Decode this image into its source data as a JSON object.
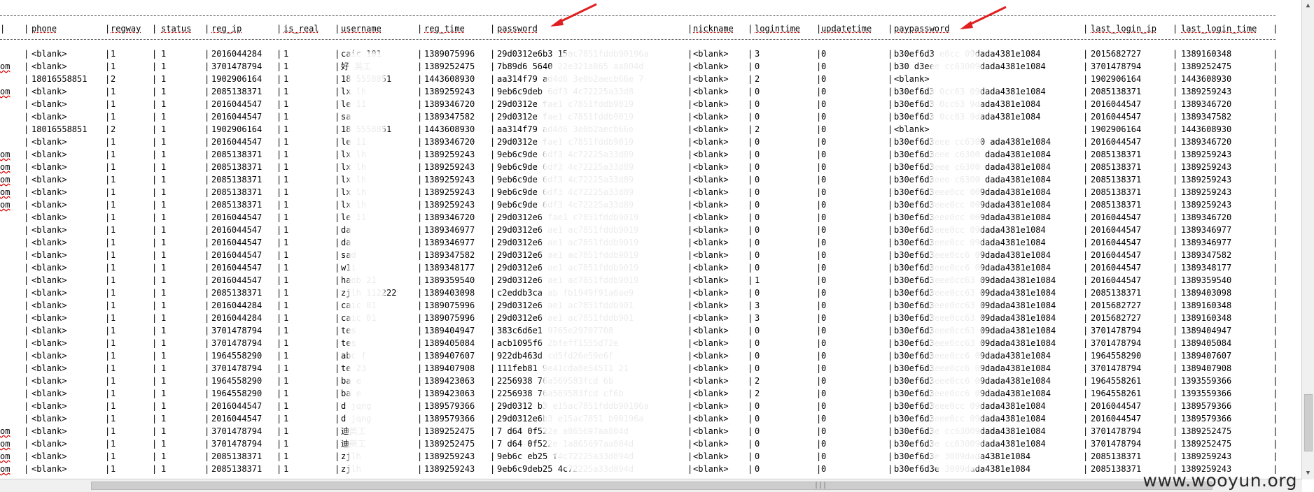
{
  "watermark": "www.wooyun.org",
  "columns": [
    "phone",
    "regway",
    "status",
    "reg_ip",
    "is_real",
    "username",
    "reg_time",
    "password",
    "nickname",
    "logintime",
    "updatetime",
    "paypassword",
    "last_login_ip",
    "last_login_time"
  ],
  "rows": [
    {
      "lead": "",
      "phone": "<blank>",
      "regway": "1",
      "status": "1",
      "reg_ip": "2016044284",
      "is_real": "1",
      "username": "caic  101",
      "reg_time": "1389075996",
      "password": "29d0312e6b3  15ac7851fddb90196a",
      "nickname": "<blank>",
      "logintime": "3",
      "updatetime": "0",
      "paypassword": "b30ef6d3  e0cc  09dada4381e1084",
      "last_login_ip": "2015682727",
      "last_login_time": "1389160348"
    },
    {
      "lead": "om",
      "phone": "<blank>",
      "regway": "1",
      "status": "1",
      "reg_ip": "3701478794",
      "is_real": "1",
      "username": "好  美工",
      "reg_time": "1389252475",
      "password": "7b89d6  5640  22e321a865  aa804d",
      "nickname": "<blank>",
      "logintime": "0",
      "updatetime": "0",
      "paypassword": "b30  d3eee  cc63009dada4381e1084",
      "last_login_ip": "3701478794",
      "last_login_time": "1389252475"
    },
    {
      "lead": "",
      "phone": "18016558851",
      "regway": "2",
      "status": "1",
      "reg_ip": "1902906164",
      "is_real": "1",
      "username": "18  5558851",
      "reg_time": "1443608930",
      "password": "aa314f79  ad4d6  3e0b2aecb66e  7",
      "nickname": "<blank>",
      "logintime": "2",
      "updatetime": "0",
      "paypassword": "<blank>",
      "last_login_ip": "1902906164",
      "last_login_time": "1443608930"
    },
    {
      "lead": "om",
      "phone": "<blank>",
      "regway": "1",
      "status": "1",
      "reg_ip": "2085138371",
      "is_real": "1",
      "username": "lx  lh",
      "reg_time": "1389259243",
      "password": "9eb6c9deb  6df3  4c72225a33d8",
      "nickname": "<blank>",
      "logintime": "0",
      "updatetime": "0",
      "paypassword": "b30ef6d3  0cc63  09dada4381e1084",
      "last_login_ip": "2085138371",
      "last_login_time": "1389259243"
    },
    {
      "lead": "",
      "phone": "<blank>",
      "regway": "1",
      "status": "1",
      "reg_ip": "2016044547",
      "is_real": "1",
      "username": "le  11",
      "reg_time": "1389346720",
      "password": "29d0312e  fae1  c7851fddb9019",
      "nickname": "<blank>",
      "logintime": "0",
      "updatetime": "0",
      "paypassword": "b30ef6d3  0cc63  9dada4381e1084",
      "last_login_ip": "2016044547",
      "last_login_time": "1389346720"
    },
    {
      "lead": "",
      "phone": "<blank>",
      "regway": "1",
      "status": "1",
      "reg_ip": "2016044547",
      "is_real": "1",
      "username": "sa",
      "reg_time": "1389347582",
      "password": "29d0312e  fae1  c7851fddb9019",
      "nickname": "<blank>",
      "logintime": "0",
      "updatetime": "0",
      "paypassword": "b30ef6d3  0cc63  9dada4381e1084",
      "last_login_ip": "2016044547",
      "last_login_time": "1389347582"
    },
    {
      "lead": "",
      "phone": "18016558851",
      "regway": "2",
      "status": "1",
      "reg_ip": "1902906164",
      "is_real": "1",
      "username": "18  5558851",
      "reg_time": "1443608930",
      "password": "aa314f79  ad4d6  3e0b2aecb66e",
      "nickname": "<blank>",
      "logintime": "2",
      "updatetime": "0",
      "paypassword": "<blank>",
      "last_login_ip": "1902906164",
      "last_login_time": "1443608930"
    },
    {
      "lead": "",
      "phone": "<blank>",
      "regway": "1",
      "status": "1",
      "reg_ip": "2016044547",
      "is_real": "1",
      "username": "le  11",
      "reg_time": "1389346720",
      "password": "29d0312e  fae1  c7851fddb9019",
      "nickname": "<blank>",
      "logintime": "0",
      "updatetime": "0",
      "paypassword": "b30ef6d3eee  cc6300  ada4381e1084",
      "last_login_ip": "2016044547",
      "last_login_time": "1389346720"
    },
    {
      "lead": "om",
      "phone": "<blank>",
      "regway": "1",
      "status": "1",
      "reg_ip": "2085138371",
      "is_real": "1",
      "username": "lx  lh",
      "reg_time": "1389259243",
      "password": "9eb6c9de  6df3  4c72225a33d89",
      "nickname": "<blank>",
      "logintime": "0",
      "updatetime": "0",
      "paypassword": "b30ef6d3eee  c6300  dada4381e1084",
      "last_login_ip": "2085138371",
      "last_login_time": "1389259243"
    },
    {
      "lead": "om",
      "phone": "<blank>",
      "regway": "1",
      "status": "1",
      "reg_ip": "2085138371",
      "is_real": "1",
      "username": "lx  lh",
      "reg_time": "1389259243",
      "password": "9eb6c9de  6df3  4c72225a33d89",
      "nickname": "<blank>",
      "logintime": "0",
      "updatetime": "0",
      "paypassword": "b30ef6d3eee  c6300  dada4381e1084",
      "last_login_ip": "2085138371",
      "last_login_time": "1389259243"
    },
    {
      "lead": "om",
      "phone": "<blank>",
      "regway": "1",
      "status": "1",
      "reg_ip": "2085138371",
      "is_real": "1",
      "username": "lx  lh",
      "reg_time": "1389259243",
      "password": "9eb6c9de  6df3  4c72225a33d89",
      "nickname": "<blank>",
      "logintime": "0",
      "updatetime": "0",
      "paypassword": "b30ef6d3eee  c6300  dada4381e1084",
      "last_login_ip": "2085138371",
      "last_login_time": "1389259243"
    },
    {
      "lead": "om",
      "phone": "<blank>",
      "regway": "1",
      "status": "1",
      "reg_ip": "2085138371",
      "is_real": "1",
      "username": "lx  lh",
      "reg_time": "1389259243",
      "password": "9eb6c9de  6df3  4c72225a33d89",
      "nickname": "<blank>",
      "logintime": "0",
      "updatetime": "0",
      "paypassword": "b30ef6d3eee0cc  009dada4381e1084",
      "last_login_ip": "2085138371",
      "last_login_time": "1389259243"
    },
    {
      "lead": "om",
      "phone": "<blank>",
      "regway": "1",
      "status": "1",
      "reg_ip": "2085138371",
      "is_real": "1",
      "username": "lx  lh",
      "reg_time": "1389259243",
      "password": "9eb6c9de  6df3  4c72225a33d89",
      "nickname": "<blank>",
      "logintime": "0",
      "updatetime": "0",
      "paypassword": "b30ef6d3eee0cc  009dada4381e1084",
      "last_login_ip": "2085138371",
      "last_login_time": "1389259243"
    },
    {
      "lead": "",
      "phone": "<blank>",
      "regway": "1",
      "status": "1",
      "reg_ip": "2016044547",
      "is_real": "1",
      "username": "le  11",
      "reg_time": "1389346720",
      "password": "29d0312e6  fae1  c7851fddb9019",
      "nickname": "<blank>",
      "logintime": "0",
      "updatetime": "0",
      "paypassword": "b30ef6d3eee0cc  009dada4381e1084",
      "last_login_ip": "2016044547",
      "last_login_time": "1389346720"
    },
    {
      "lead": "",
      "phone": "<blank>",
      "regway": "1",
      "status": "1",
      "reg_ip": "2016044547",
      "is_real": "1",
      "username": "da",
      "reg_time": "1389346977",
      "password": "29d0312e6  ae1  ac7851fddb9019",
      "nickname": "<blank>",
      "logintime": "0",
      "updatetime": "0",
      "paypassword": "b30ef6d3eee0cc  09dada4381e1084",
      "last_login_ip": "2016044547",
      "last_login_time": "1389346977"
    },
    {
      "lead": "",
      "phone": "<blank>",
      "regway": "1",
      "status": "1",
      "reg_ip": "2016044547",
      "is_real": "1",
      "username": "da",
      "reg_time": "1389346977",
      "password": "29d0312e6  ae1  ac7851fddb9019",
      "nickname": "<blank>",
      "logintime": "0",
      "updatetime": "0",
      "paypassword": "b30ef6d3eee0cc  09dada4381e1084",
      "last_login_ip": "2016044547",
      "last_login_time": "1389346977"
    },
    {
      "lead": "",
      "phone": "<blank>",
      "regway": "1",
      "status": "1",
      "reg_ip": "2016044547",
      "is_real": "1",
      "username": "sad",
      "reg_time": "1389347582",
      "password": "29d0312e6  ae1  ac7851fddb9019",
      "nickname": "<blank>",
      "logintime": "0",
      "updatetime": "0",
      "paypassword": "b30ef6d3eee0cc6  09dada4381e1084",
      "last_login_ip": "2016044547",
      "last_login_time": "1389347582"
    },
    {
      "lead": "",
      "phone": "<blank>",
      "regway": "1",
      "status": "1",
      "reg_ip": "2016044547",
      "is_real": "1",
      "username": "w1i",
      "reg_time": "1389348177",
      "password": "29d0312e6  ae1  ac7851fddb9019",
      "nickname": "<blank>",
      "logintime": "0",
      "updatetime": "0",
      "paypassword": "b30ef6d3eee0cc6  09dada4381e1084",
      "last_login_ip": "2016044547",
      "last_login_time": "1389348177"
    },
    {
      "lead": "",
      "phone": "<blank>",
      "regway": "1",
      "status": "1",
      "reg_ip": "2016044547",
      "is_real": "1",
      "username": "haob  21",
      "reg_time": "1389359540",
      "password": "29d0312e6  ae1  ac7851fddb9019",
      "nickname": "<blank>",
      "logintime": "1",
      "updatetime": "0",
      "paypassword": "b30ef6d3eee0cc63  09dada4381e1084",
      "last_login_ip": "2016044547",
      "last_login_time": "1389359540"
    },
    {
      "lead": "",
      "phone": "<blank>",
      "regway": "1",
      "status": "1",
      "reg_ip": "2085138371",
      "is_real": "1",
      "username": "zjlh  112222",
      "reg_time": "1389403098",
      "password": "c2eddb3ca  ab  fb1949f91a6ae9",
      "nickname": "<blank>",
      "logintime": "0",
      "updatetime": "0",
      "paypassword": "b30ef6d3eee0cc63  09dada4381e1084",
      "last_login_ip": "2085138371",
      "last_login_time": "1389403098"
    },
    {
      "lead": "",
      "phone": "<blank>",
      "regway": "1",
      "status": "1",
      "reg_ip": "2016044284",
      "is_real": "1",
      "username": "caic  01",
      "reg_time": "1389075996",
      "password": "29d0312e6  ae1  ac7851fddb901",
      "nickname": "<blank>",
      "logintime": "3",
      "updatetime": "0",
      "paypassword": "b30ef6d3eee0cc63  09dada4381e1084",
      "last_login_ip": "2015682727",
      "last_login_time": "1389160348"
    },
    {
      "lead": "",
      "phone": "<blank>",
      "regway": "1",
      "status": "1",
      "reg_ip": "2016044284",
      "is_real": "1",
      "username": "caic  01",
      "reg_time": "1389075996",
      "password": "29d0312e6  ae1  ac7851fddb901",
      "nickname": "<blank>",
      "logintime": "3",
      "updatetime": "0",
      "paypassword": "b30ef6d3eee0cc63  09dada4381e1084",
      "last_login_ip": "2015682727",
      "last_login_time": "1389160348"
    },
    {
      "lead": "",
      "phone": "<blank>",
      "regway": "1",
      "status": "1",
      "reg_ip": "3701478794",
      "is_real": "1",
      "username": "tes",
      "reg_time": "1389404947",
      "password": "383c6d6e1  9765e29707708",
      "nickname": "<blank>",
      "logintime": "0",
      "updatetime": "0",
      "paypassword": "b30ef6d3eee0cc63  09dada4381e1084",
      "last_login_ip": "3701478794",
      "last_login_time": "1389404947"
    },
    {
      "lead": "",
      "phone": "<blank>",
      "regway": "1",
      "status": "1",
      "reg_ip": "3701478794",
      "is_real": "1",
      "username": "tes",
      "reg_time": "1389405084",
      "password": "acb1095f6  2bfeff1555d72e",
      "nickname": "<blank>",
      "logintime": "0",
      "updatetime": "0",
      "paypassword": "b30ef6d3eee0cc63  09dada4381e1084",
      "last_login_ip": "3701478794",
      "last_login_time": "1389405084"
    },
    {
      "lead": "",
      "phone": "<blank>",
      "regway": "1",
      "status": "1",
      "reg_ip": "1964558290",
      "is_real": "1",
      "username": "abc  f",
      "reg_time": "1389407607",
      "password": "922db463d  cd5fd26e59e6f",
      "nickname": "<blank>",
      "logintime": "0",
      "updatetime": "0",
      "paypassword": "b30ef6d3eee0cc6  09dada4381e1084",
      "last_login_ip": "1964558290",
      "last_login_time": "1389407607"
    },
    {
      "lead": "",
      "phone": "<blank>",
      "regway": "1",
      "status": "1",
      "reg_ip": "3701478794",
      "is_real": "1",
      "username": "te  23",
      "reg_time": "1389407908",
      "password": "111feb81  9e41cda8e54511  21",
      "nickname": "<blank>",
      "logintime": "0",
      "updatetime": "0",
      "paypassword": "b30ef6d3eee0cc6  09dada4381e1084",
      "last_login_ip": "3701478794",
      "last_login_time": "1389407908"
    },
    {
      "lead": "",
      "phone": "<blank>",
      "regway": "1",
      "status": "1",
      "reg_ip": "1964558290",
      "is_real": "1",
      "username": "ba  e",
      "reg_time": "1389423063",
      "password": "2256938  76a569583fcd  6b",
      "nickname": "<blank>",
      "logintime": "2",
      "updatetime": "0",
      "paypassword": "b30ef6d3eee0cc6  09dada4381e1084",
      "last_login_ip": "1964558261",
      "last_login_time": "1393559366"
    },
    {
      "lead": "",
      "phone": "<blank>",
      "regway": "1",
      "status": "1",
      "reg_ip": "1964558290",
      "is_real": "1",
      "username": "ba  e",
      "reg_time": "1389423063",
      "password": "2256938  76a569583fcd  cf6b",
      "nickname": "<blank>",
      "logintime": "2",
      "updatetime": "0",
      "paypassword": "b30ef6d3eee0cc6  09dada4381e1084",
      "last_login_ip": "1964558261",
      "last_login_time": "1393559366"
    },
    {
      "lead": "",
      "phone": "<blank>",
      "regway": "1",
      "status": "1",
      "reg_ip": "2016044547",
      "is_real": "1",
      "username": "d  jqng",
      "reg_time": "1389579366",
      "password": "29d0312  b3  e15ac7851fddb90196a",
      "nickname": "<blank>",
      "logintime": "0",
      "updatetime": "0",
      "paypassword": "b30ef6d3eee0cc  09dada4381e1084",
      "last_login_ip": "2016044547",
      "last_login_time": "1389579366"
    },
    {
      "lead": "",
      "phone": "<blank>",
      "regway": "1",
      "status": "1",
      "reg_ip": "2016044547",
      "is_real": "1",
      "username": "d  jqng",
      "reg_time": "1389579366",
      "password": "29d0312e6b3  e15ac7851  b90196a",
      "nickname": "<blank>",
      "logintime": "0",
      "updatetime": "0",
      "paypassword": "b30ef6d3eee0cc  09dada4381e1084",
      "last_login_ip": "2016044547",
      "last_login_time": "1389579366"
    },
    {
      "lead": "om",
      "phone": "<blank>",
      "regway": "1",
      "status": "1",
      "reg_ip": "3701478794",
      "is_real": "1",
      "username": "  迪美工",
      "reg_time": "1389252475",
      "password": "7  d64  0f522e  a865697aa804d",
      "nickname": "<blank>",
      "logintime": "0",
      "updatetime": "0",
      "paypassword": "b30ef6d3e  cc63009dada4381e1084",
      "last_login_ip": "3701478794",
      "last_login_time": "1389252475"
    },
    {
      "lead": "om",
      "phone": "<blank>",
      "regway": "1",
      "status": "1",
      "reg_ip": "3701478794",
      "is_real": "1",
      "username": "  迪美工",
      "reg_time": "1389252475",
      "password": "7  d64  0f522e  1a865697aa804d",
      "nickname": "<blank>",
      "logintime": "0",
      "updatetime": "0",
      "paypassword": "b30ef6d3e  cc63009dada4381e1084",
      "last_login_ip": "3701478794",
      "last_login_time": "1389252475"
    },
    {
      "lead": "om",
      "phone": "<blank>",
      "regway": "1",
      "status": "1",
      "reg_ip": "2085138371",
      "is_real": "1",
      "username": "  zjlh",
      "reg_time": "1389259243",
      "password": "9eb6c  eb25  f4c72225a33d894d",
      "nickname": "<blank>",
      "logintime": "0",
      "updatetime": "0",
      "paypassword": "b30ef6d3e  3009dada4381e1084",
      "last_login_ip": "2085138371",
      "last_login_time": "1389259243"
    },
    {
      "lead": "om",
      "phone": "<blank>",
      "regway": "1",
      "status": "1",
      "reg_ip": "2085138371",
      "is_real": "1",
      "username": "  zjlh",
      "reg_time": "1389259243",
      "password": "9eb6c9deb25  4c72225a33d894d",
      "nickname": "<blank>",
      "logintime": "0",
      "updatetime": "0",
      "paypassword": "b30ef6d3e  3009dada4381e1084",
      "last_login_ip": "2085138371",
      "last_login_time": "1389259243"
    }
  ]
}
